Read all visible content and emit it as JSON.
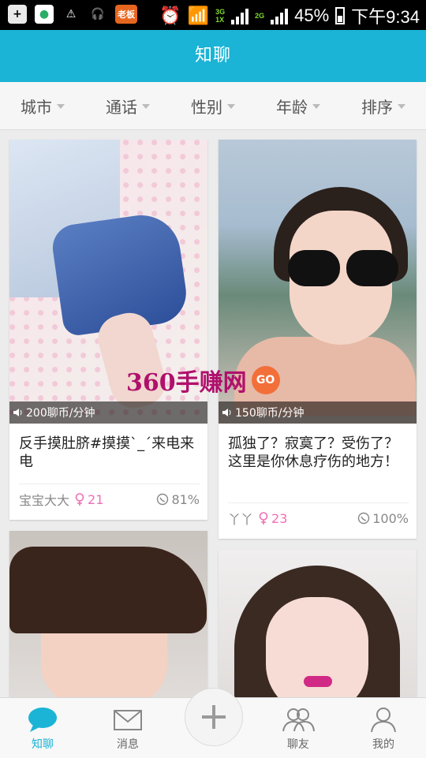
{
  "status_bar": {
    "signal_3g_label": "3G\n1X",
    "signal_2g_label": "2G",
    "battery": "45%",
    "time": "下午9:34",
    "app_badge": "老板"
  },
  "header": {
    "title": "知聊"
  },
  "filters": [
    "城市",
    "通话",
    "性别",
    "年龄",
    "排序"
  ],
  "cards": [
    {
      "price": "200聊币/分钟",
      "title": "反手摸肚脐#摸摸ˋ_ˊ来电来电",
      "username": "宝宝大大",
      "age": "21",
      "rate": "81%"
    },
    {
      "price": "150聊币/分钟",
      "title": "孤独了？寂寞了？受伤了？这里是你休息疗伤的地方！",
      "username": "丫丫",
      "age": "23",
      "rate": "100%"
    }
  ],
  "watermark": {
    "text": "360手赚网",
    "badge": "GO"
  },
  "bottom_nav": {
    "items": [
      "知聊",
      "消息",
      "聊友",
      "我的"
    ]
  },
  "colors": {
    "accent": "#1bb4d6",
    "female": "#f06fb4"
  }
}
